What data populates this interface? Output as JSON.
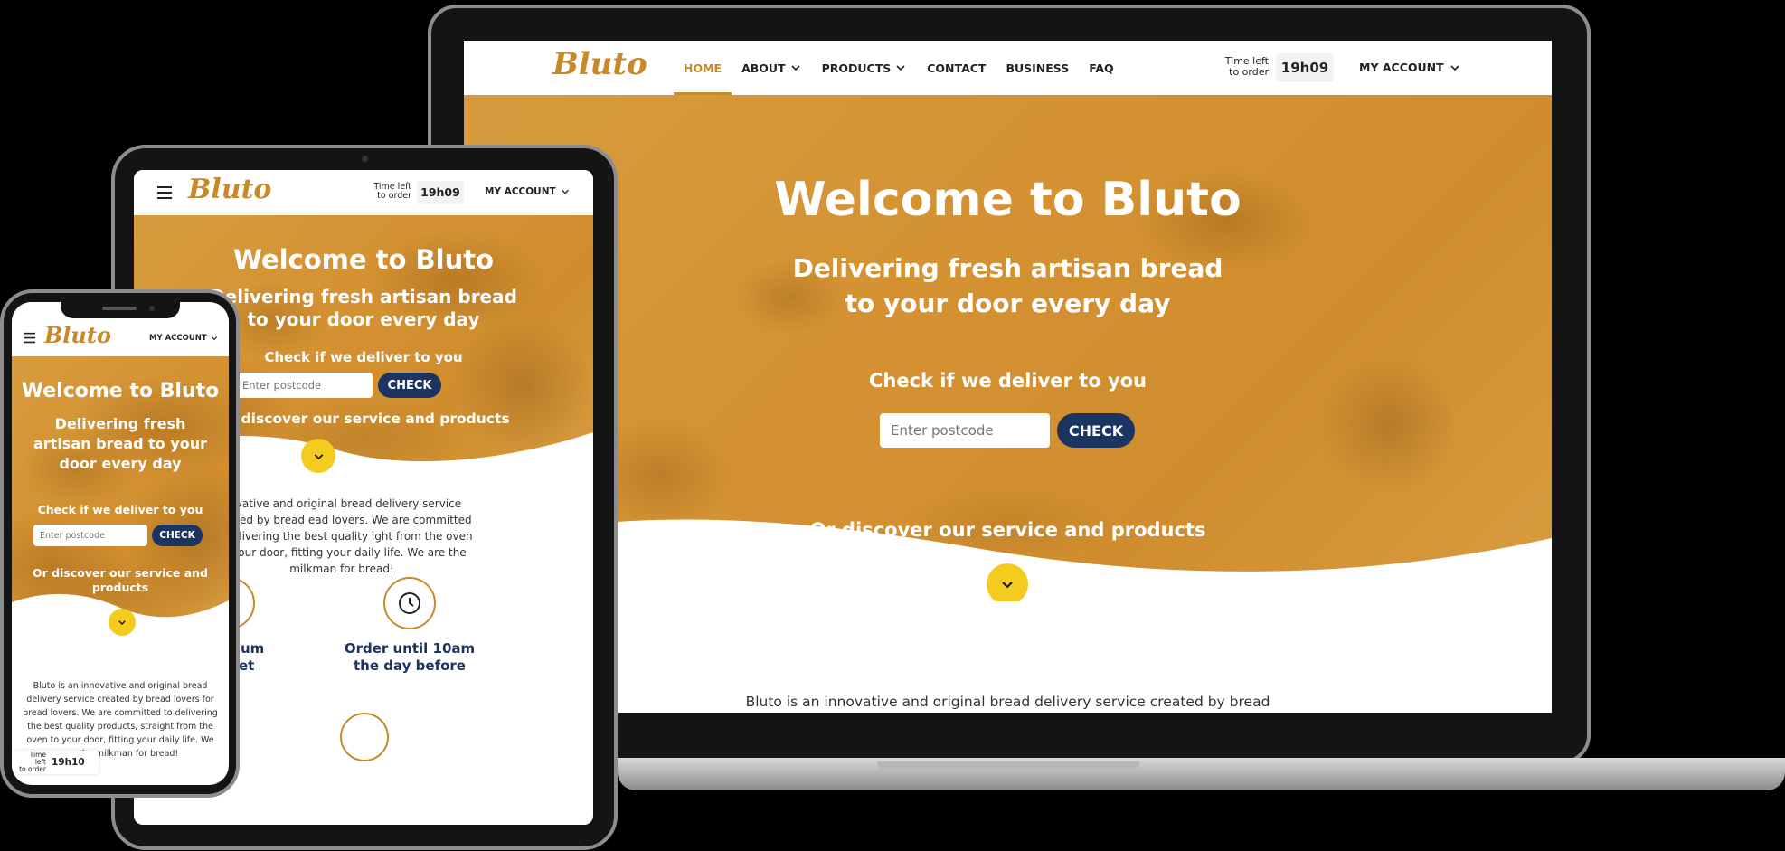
{
  "brand": {
    "logo_text": "Bluto",
    "accent": "#c8892b",
    "hero_color": "#d49232",
    "button_color": "#1c3461",
    "arrow_color": "#f4cb1f"
  },
  "nav": {
    "items": [
      {
        "label": "HOME"
      },
      {
        "label": "ABOUT"
      },
      {
        "label": "PRODUCTS"
      },
      {
        "label": "CONTACT"
      },
      {
        "label": "BUSINESS"
      },
      {
        "label": "FAQ"
      }
    ],
    "account_label": "MY ACCOUNT"
  },
  "timer": {
    "label_line1": "Time left",
    "label_line2": "to order",
    "value": "19h09",
    "phone_value": "19h10"
  },
  "hero": {
    "title": "Welcome to Bluto",
    "subtitle_line1": "Delivering fresh artisan bread",
    "subtitle_line2": "to your door every day",
    "phone_subtitle": "Delivering fresh artisan bread to your door every day",
    "check_label": "Check if we deliver to you",
    "postcode_placeholder": "Enter postcode",
    "check_button": "CHECK",
    "discover_text": "Or discover our service and products"
  },
  "intro": {
    "laptop_text": "Bluto is an innovative and original bread delivery service created by bread",
    "tablet_text": "novative and original bread delivery service created by bread ead lovers. We are committed to delivering the best quality ight from the oven to your door, fitting your daily life. We are the milkman for bread!",
    "phone_text": "Bluto is an innovative and original bread delivery service created by bread lovers for bread lovers. We are committed to delivering the best quality products, straight from the oven to your door, fitting your daily life. We are the milkman for bread!"
  },
  "features": [
    {
      "icon": "basket-icon",
      "line1": "minimum",
      "line2": "basket"
    },
    {
      "icon": "clock-icon",
      "line1": "Order until 10am",
      "line2": "the day before"
    }
  ]
}
